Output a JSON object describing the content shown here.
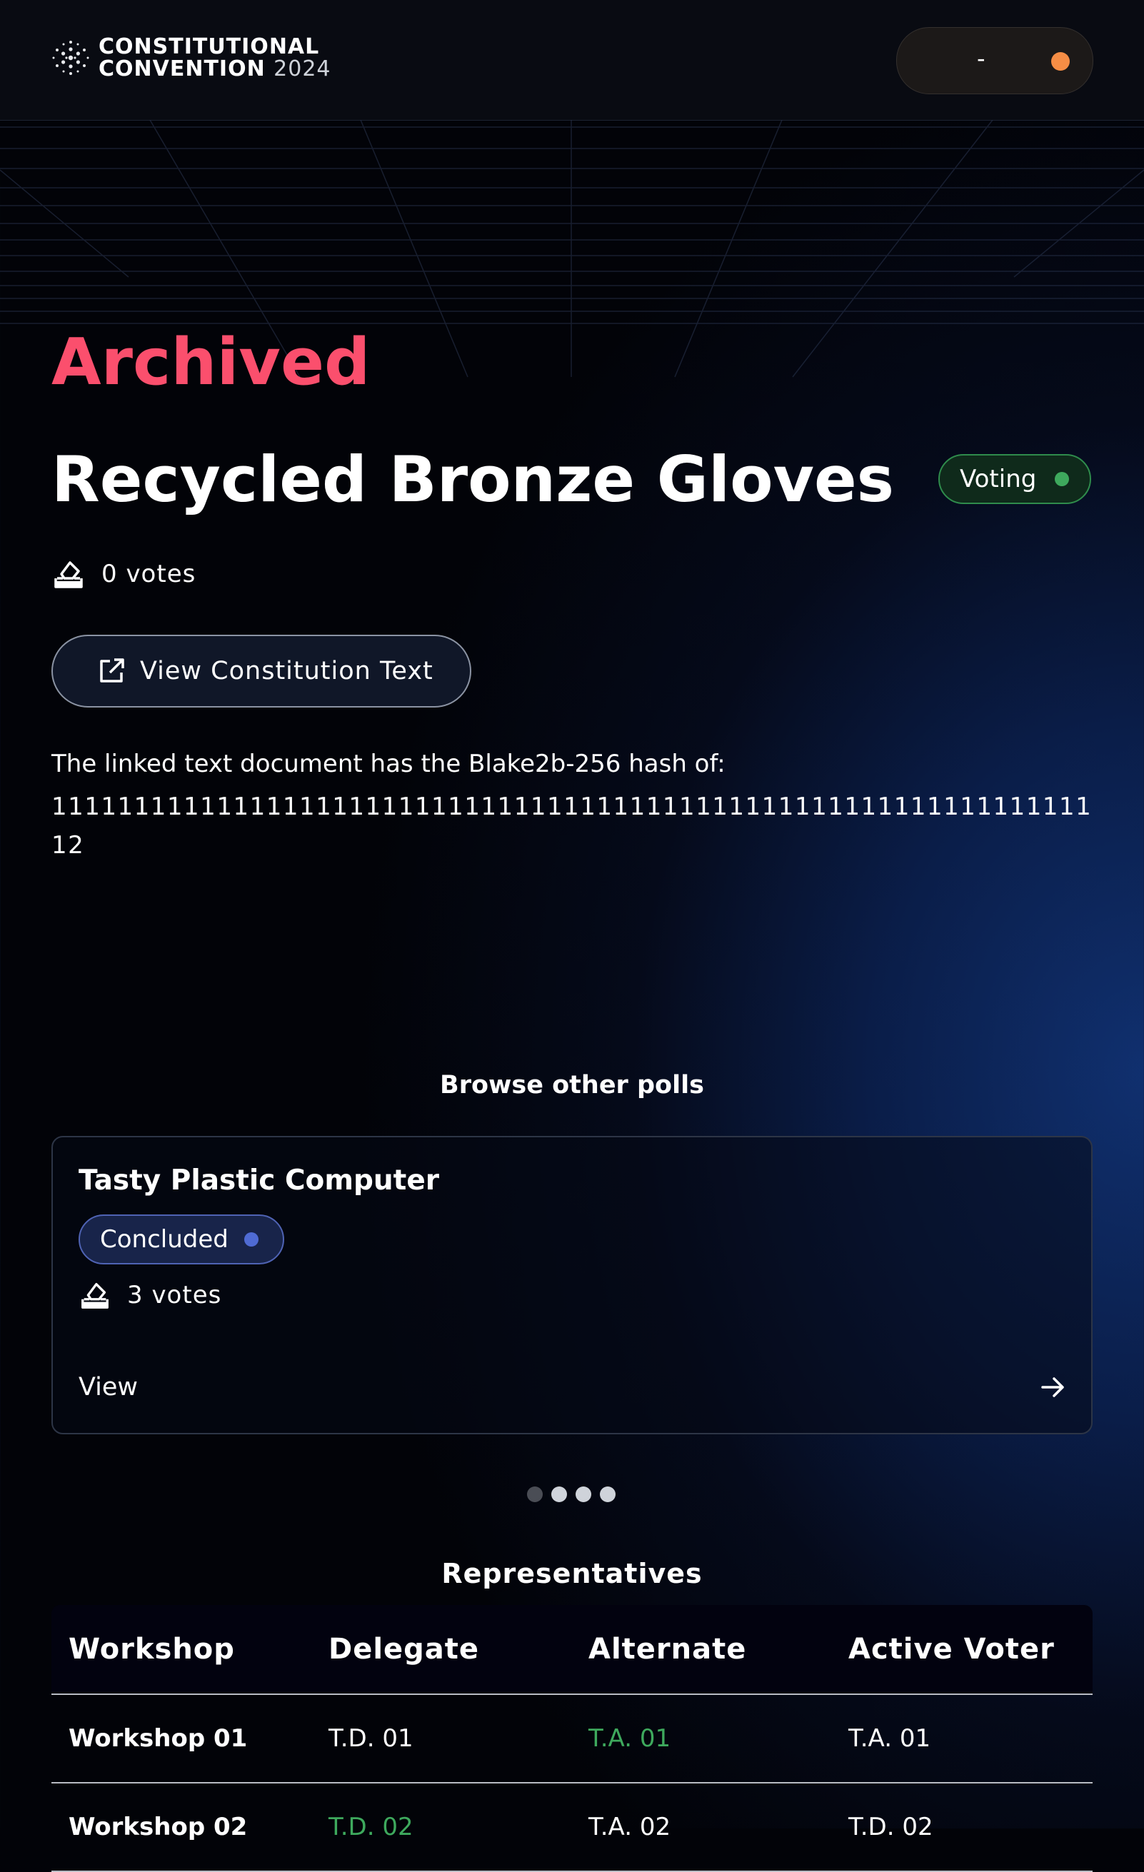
{
  "header": {
    "logo_line1": "CONSTITUTIONAL",
    "logo_line2": "CONVENTION",
    "logo_year": "2024",
    "wallet_text": "-"
  },
  "poll": {
    "archived_label": "Archived",
    "title": "Recycled Bronze Gloves",
    "status": "Voting",
    "votes": "0 votes",
    "view_button": "View Constitution Text",
    "hash_intro": "The linked text document has the Blake2b-256 hash of:",
    "hash_value": "11111111111111111111111111111111111111111111111111111111111111112"
  },
  "browse": {
    "heading": "Browse other polls",
    "card": {
      "title": "Tasty Plastic Computer",
      "status": "Concluded",
      "votes": "3 votes",
      "view": "View"
    }
  },
  "representatives": {
    "heading": "Representatives",
    "columns": [
      "Workshop",
      "Delegate",
      "Alternate",
      "Active Voter"
    ],
    "rows": [
      [
        "Workshop 01",
        "T.D. 01",
        "T.A. 01",
        "T.A. 01"
      ],
      [
        "Workshop 02",
        "T.D. 02",
        "T.A. 02",
        "T.D. 02"
      ]
    ]
  },
  "colors": {
    "archived": "#fb4f6d",
    "voting_green": "#3ea95d",
    "concluded_blue": "#4f6bd3",
    "wallet_dot": "#f58d45"
  }
}
